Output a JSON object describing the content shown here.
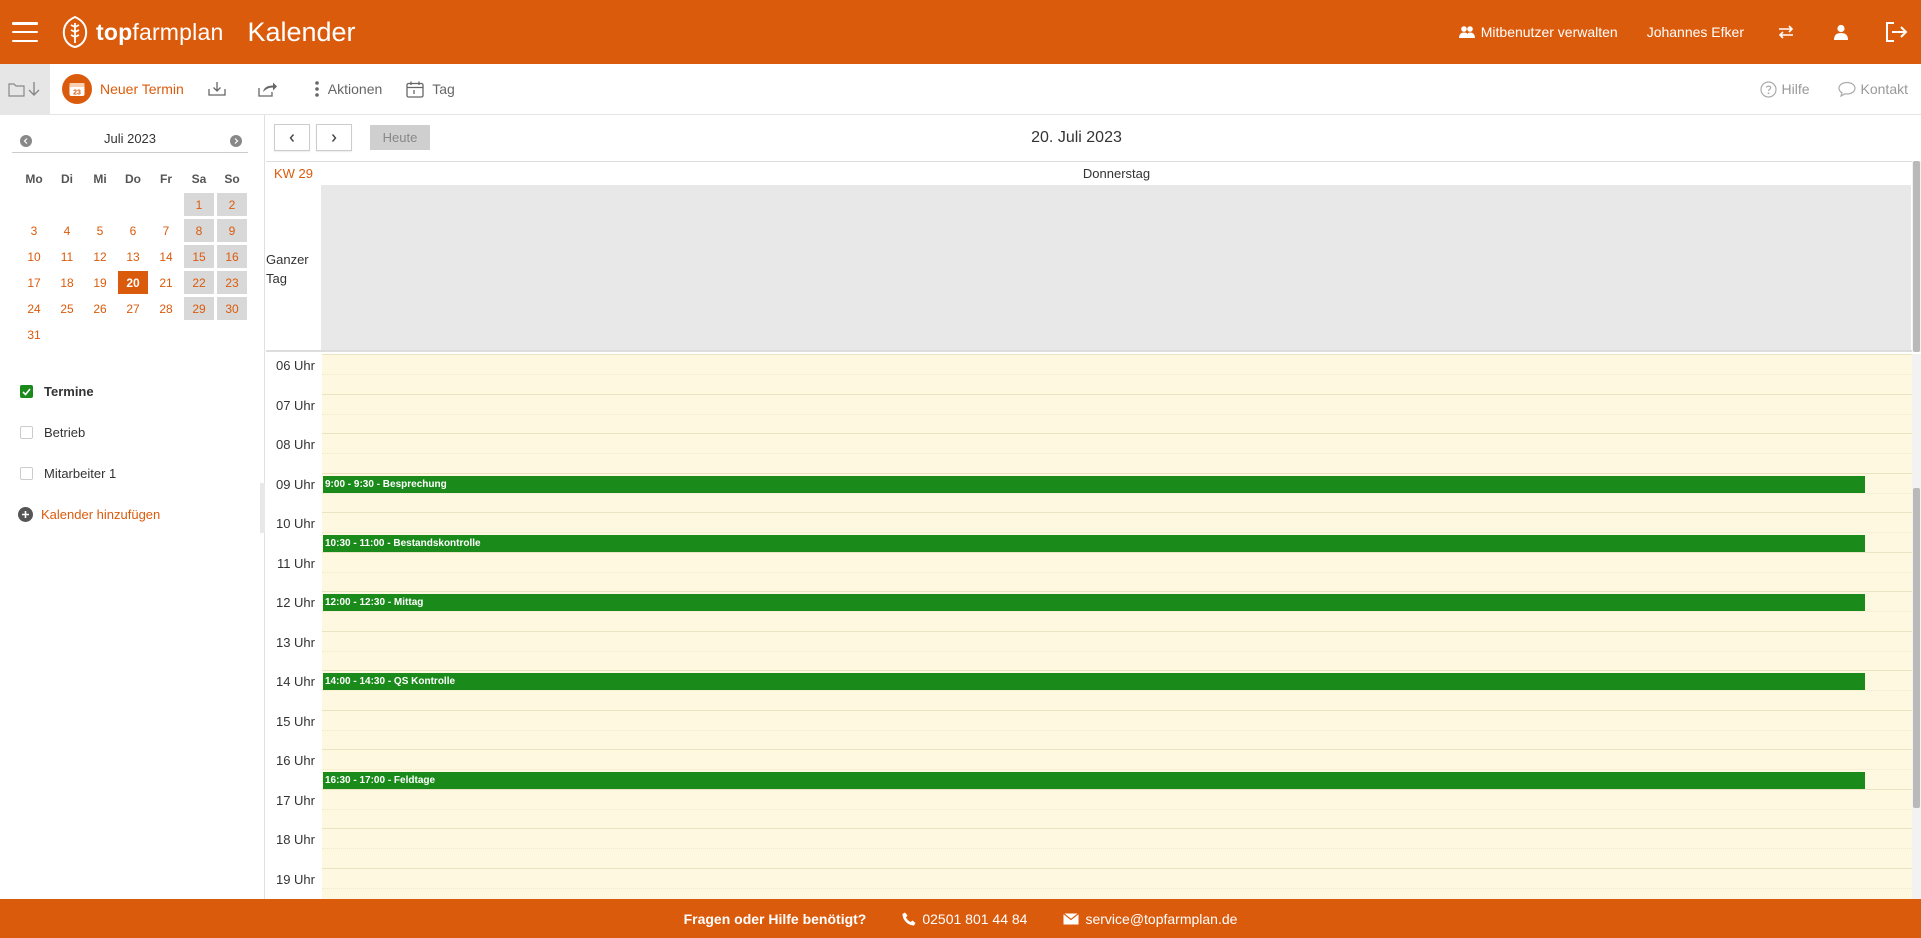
{
  "header": {
    "logo_bold": "top",
    "logo_light": "farmplan",
    "title": "Kalender",
    "users_label": "Mitbenutzer verwalten",
    "user_name": "Johannes Efker"
  },
  "toolbar": {
    "new_label": "Neuer Termin",
    "new_icon_day": "23",
    "actions_label": "Aktionen",
    "view_label": "Tag",
    "help_label": "Hilfe",
    "contact_label": "Kontakt"
  },
  "mini_calendar": {
    "title": "Juli 2023",
    "weekdays": [
      "Mo",
      "Di",
      "Mi",
      "Do",
      "Fr",
      "Sa",
      "So"
    ],
    "weeks": [
      [
        "",
        "",
        "",
        "",
        "",
        "1",
        "2"
      ],
      [
        "3",
        "4",
        "5",
        "6",
        "7",
        "8",
        "9"
      ],
      [
        "10",
        "11",
        "12",
        "13",
        "14",
        "15",
        "16"
      ],
      [
        "17",
        "18",
        "19",
        "20",
        "21",
        "22",
        "23"
      ],
      [
        "24",
        "25",
        "26",
        "27",
        "28",
        "29",
        "30"
      ],
      [
        "31",
        "",
        "",
        "",
        "",
        "",
        ""
      ]
    ],
    "today": "20"
  },
  "calendars": {
    "items": [
      {
        "label": "Termine",
        "checked": true
      },
      {
        "label": "Betrieb",
        "checked": false
      },
      {
        "label": "Mitarbeiter 1",
        "checked": false
      }
    ],
    "add_label": "Kalender hinzufügen"
  },
  "calendar": {
    "today_label": "Heute",
    "title": "20. Juli 2023",
    "week_label": "KW 29",
    "day_name": "Donnerstag",
    "allday_label": "Ganzer Tag",
    "hours": [
      "06 Uhr",
      "07 Uhr",
      "08 Uhr",
      "09 Uhr",
      "10 Uhr",
      "11 Uhr",
      "12 Uhr",
      "13 Uhr",
      "14 Uhr",
      "15 Uhr",
      "16 Uhr",
      "17 Uhr",
      "18 Uhr",
      "19 Uhr"
    ],
    "first_hour": 6,
    "events": [
      {
        "label": "9:00 - 9:30 - Besprechung",
        "start": 9.0
      },
      {
        "label": "10:30 - 11:00 - Bestandskontrolle",
        "start": 10.5
      },
      {
        "label": "12:00 - 12:30 - Mittag",
        "start": 12.0
      },
      {
        "label": "14:00 - 14:30 - QS Kontrolle",
        "start": 14.0
      },
      {
        "label": "16:30 - 17:00 - Feldtage",
        "start": 16.5
      }
    ]
  },
  "footer": {
    "question": "Fragen oder Hilfe benötigt?",
    "phone": "02501 801 44 84",
    "email": "service@topfarmplan.de"
  },
  "colors": {
    "brand": "#db5b0c",
    "event": "#1a8a1a",
    "grid_bg": "#fdf8df",
    "allday_bg": "#e8e8e8"
  }
}
